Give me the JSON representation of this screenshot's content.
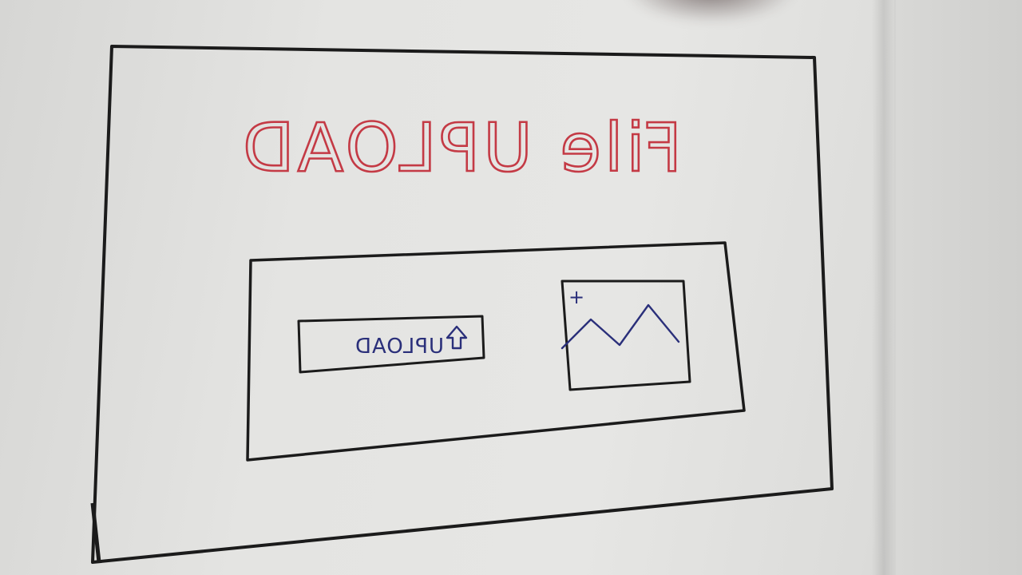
{
  "screen": {
    "title": "File UPLOAD",
    "upload_button_label": "UPLOAD",
    "preview_plus_glyph": "+"
  },
  "icons": {
    "upload_arrow": "upload-arrow-icon",
    "chart_preview": "line-chart-icon"
  },
  "colors": {
    "title_ink": "#c43a45",
    "pen_ink": "#1b1b1b",
    "button_ink": "#2a2f7a",
    "paper": "#e4e4e2"
  }
}
